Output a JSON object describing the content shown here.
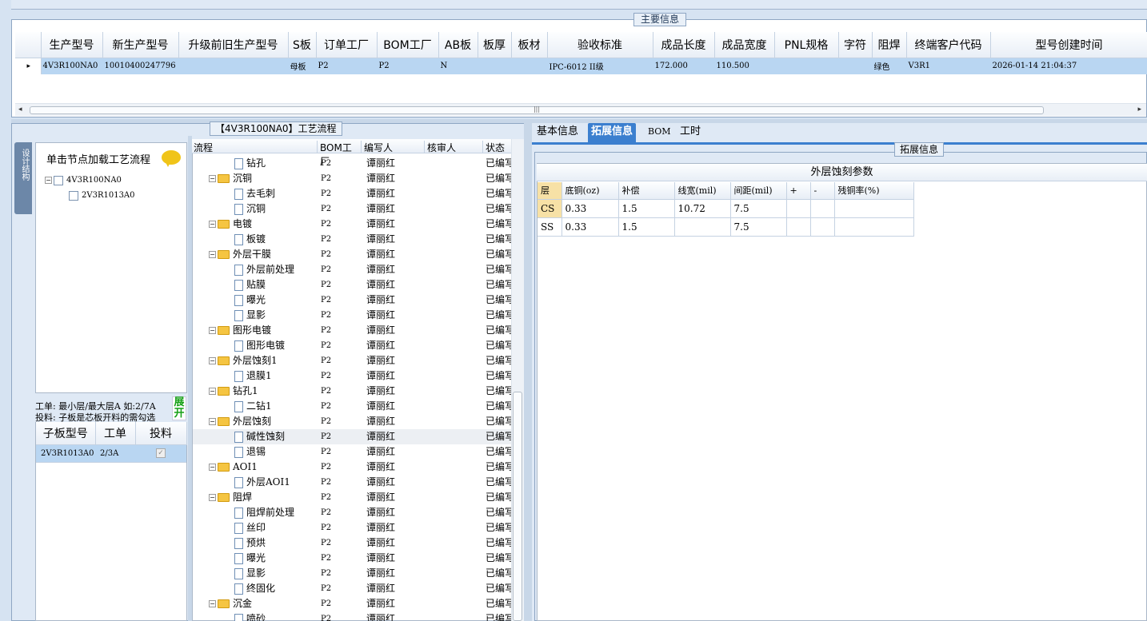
{
  "main_info": {
    "legend": "主要信息",
    "columns": [
      "生产型号",
      "新生产型号",
      "升级前旧生产型号",
      "S板",
      "订单工厂",
      "BOM工厂",
      "AB板",
      "板厚",
      "板材",
      "验收标准",
      "成品长度",
      "成品宽度",
      "PNL规格",
      "字符",
      "阻焊",
      "终端客户代码",
      "型号创建时间"
    ],
    "row": [
      "4V3R100NA0",
      "10010400247796",
      "",
      "母板",
      "P2",
      "P2",
      "N",
      "",
      "",
      "IPC-6012 II级",
      "172.000",
      "110.500",
      "",
      "",
      "绿色",
      "V3R1",
      "2026-01-14 21:04:37"
    ],
    "scroll_mark": "|||"
  },
  "left": {
    "vertical_tab": "设计结构",
    "process_legend": "【4V3R100NA0】工艺流程",
    "tree_hint": "单击节点加载工艺流程",
    "tree_nodes": [
      "4V3R100NA0",
      "2V3R1013A0"
    ],
    "note1": "工单: 最小层/最大层A 如:2/7A",
    "note2": "投料: 子板是芯板开料的需勾选",
    "expand_label": "展开",
    "sub_columns": [
      "子板型号",
      "工单",
      "投料"
    ],
    "sub_row": [
      "2V3R1013A0",
      "2/3A",
      "✓"
    ]
  },
  "process": {
    "columns": [
      "流程",
      "BOM工厂",
      "编写人",
      "核审人",
      "状态"
    ],
    "rows": [
      {
        "name": "钻孔",
        "level": 2,
        "factory": "P2",
        "writer": "谭丽红",
        "status": "已编写"
      },
      {
        "name": "沉铜",
        "level": 1,
        "factory": "P2",
        "writer": "谭丽红",
        "status": "已编写"
      },
      {
        "name": "去毛刺",
        "level": 2,
        "factory": "P2",
        "writer": "谭丽红",
        "status": "已编写"
      },
      {
        "name": "沉铜",
        "level": 2,
        "factory": "P2",
        "writer": "谭丽红",
        "status": "已编写"
      },
      {
        "name": "电镀",
        "level": 1,
        "factory": "P2",
        "writer": "谭丽红",
        "status": "已编写"
      },
      {
        "name": "板镀",
        "level": 2,
        "factory": "P2",
        "writer": "谭丽红",
        "status": "已编写"
      },
      {
        "name": "外层干膜",
        "level": 1,
        "factory": "P2",
        "writer": "谭丽红",
        "status": "已编写"
      },
      {
        "name": "外层前处理",
        "level": 2,
        "factory": "P2",
        "writer": "谭丽红",
        "status": "已编写"
      },
      {
        "name": "贴膜",
        "level": 2,
        "factory": "P2",
        "writer": "谭丽红",
        "status": "已编写"
      },
      {
        "name": "曝光",
        "level": 2,
        "factory": "P2",
        "writer": "谭丽红",
        "status": "已编写"
      },
      {
        "name": "显影",
        "level": 2,
        "factory": "P2",
        "writer": "谭丽红",
        "status": "已编写"
      },
      {
        "name": "图形电镀",
        "level": 1,
        "factory": "P2",
        "writer": "谭丽红",
        "status": "已编写"
      },
      {
        "name": "图形电镀",
        "level": 2,
        "factory": "P2",
        "writer": "谭丽红",
        "status": "已编写"
      },
      {
        "name": "外层蚀刻1",
        "level": 1,
        "factory": "P2",
        "writer": "谭丽红",
        "status": "已编写"
      },
      {
        "name": "退膜1",
        "level": 2,
        "factory": "P2",
        "writer": "谭丽红",
        "status": "已编写"
      },
      {
        "name": "钻孔1",
        "level": 1,
        "factory": "P2",
        "writer": "谭丽红",
        "status": "已编写"
      },
      {
        "name": "二钻1",
        "level": 2,
        "factory": "P2",
        "writer": "谭丽红",
        "status": "已编写"
      },
      {
        "name": "外层蚀刻",
        "level": 1,
        "factory": "P2",
        "writer": "谭丽红",
        "status": "已编写"
      },
      {
        "name": "碱性蚀刻",
        "level": 2,
        "factory": "P2",
        "writer": "谭丽红",
        "status": "已编写",
        "selected": true
      },
      {
        "name": "退锡",
        "level": 2,
        "factory": "P2",
        "writer": "谭丽红",
        "status": "已编写"
      },
      {
        "name": "AOI1",
        "level": 1,
        "factory": "P2",
        "writer": "谭丽红",
        "status": "已编写"
      },
      {
        "name": "外层AOI1",
        "level": 2,
        "factory": "P2",
        "writer": "谭丽红",
        "status": "已编写"
      },
      {
        "name": "阻焊",
        "level": 1,
        "factory": "P2",
        "writer": "谭丽红",
        "status": "已编写"
      },
      {
        "name": "阻焊前处理",
        "level": 2,
        "factory": "P2",
        "writer": "谭丽红",
        "status": "已编写"
      },
      {
        "name": "丝印",
        "level": 2,
        "factory": "P2",
        "writer": "谭丽红",
        "status": "已编写"
      },
      {
        "name": "预烘",
        "level": 2,
        "factory": "P2",
        "writer": "谭丽红",
        "status": "已编写"
      },
      {
        "name": "曝光",
        "level": 2,
        "factory": "P2",
        "writer": "谭丽红",
        "status": "已编写"
      },
      {
        "name": "显影",
        "level": 2,
        "factory": "P2",
        "writer": "谭丽红",
        "status": "已编写"
      },
      {
        "name": "终固化",
        "level": 2,
        "factory": "P2",
        "writer": "谭丽红",
        "status": "已编写"
      },
      {
        "name": "沉金",
        "level": 1,
        "factory": "P2",
        "writer": "谭丽红",
        "status": "已编写"
      },
      {
        "name": "喷砂",
        "level": 2,
        "factory": "P2",
        "writer": "谭丽红",
        "status": "已编写"
      }
    ]
  },
  "right": {
    "tabs": [
      "基本信息",
      "拓展信息",
      "BOM",
      "工时"
    ],
    "active_tab": 1,
    "ext_legend": "拓展信息",
    "etch_title": "外层蚀刻参数",
    "etch_columns": [
      "层",
      "底铜(oz)",
      "补偿",
      "线宽(mil)",
      "间距(mil)",
      "+",
      "-",
      "残铜率(%)"
    ],
    "etch_rows": [
      [
        "CS",
        "0.33",
        "1.5",
        "10.72",
        "7.5",
        "",
        "",
        ""
      ],
      [
        "SS",
        "0.33",
        "1.5",
        "",
        "7.5",
        "",
        "",
        ""
      ]
    ]
  },
  "colors": {
    "selection": "#b9d6f2",
    "accent": "#3b7fcf",
    "folder": "#f5c542"
  }
}
